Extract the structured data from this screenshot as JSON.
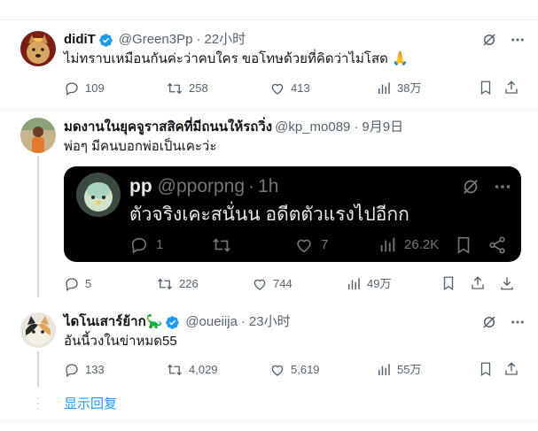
{
  "tweets": [
    {
      "name": "didiT",
      "handle": "@Green3Pp",
      "time": "22小时",
      "text": "ไม่ทราบเหมือนกันค่ะว่าคบใคร ขอโทษด้วยที่คิดว่าไม่โสด 🙏",
      "replies": "109",
      "retweets": "258",
      "likes": "413",
      "views": "38万",
      "verified": true
    },
    {
      "name": "มดงานในยุคจูราสสิคที่มีถนนให้รถวิ่ง",
      "handle": "@kp_mo089",
      "time": "9月9日",
      "text": "พ่อๆ มีคนบอกพ่อเป็นเคะว่ะ",
      "replies": "5",
      "retweets": "226",
      "likes": "744",
      "views": "49万",
      "verified": false,
      "quote": {
        "name": "pp",
        "handle": "@pporpng",
        "time": "1h",
        "text": "ตัวจริงเคะสนั่นน อดีตตัวแรงไปอีกก",
        "replies": "1",
        "likes": "7",
        "views": "26.2K"
      }
    },
    {
      "name": "ไดโนเสาร์ย้าก🦕",
      "handle": "@oueiija",
      "time": "23小时",
      "text": "อันนี้วงในข่าหมด55",
      "replies": "133",
      "retweets": "4,029",
      "likes": "5,619",
      "views": "55万",
      "verified": true
    }
  ],
  "show_replies_label": "显示回复",
  "separator_dot": "·",
  "colors": {
    "accent": "#1d9bf0",
    "text": "#0f1419",
    "secondary": "#536471",
    "border": "#eff3f4"
  }
}
